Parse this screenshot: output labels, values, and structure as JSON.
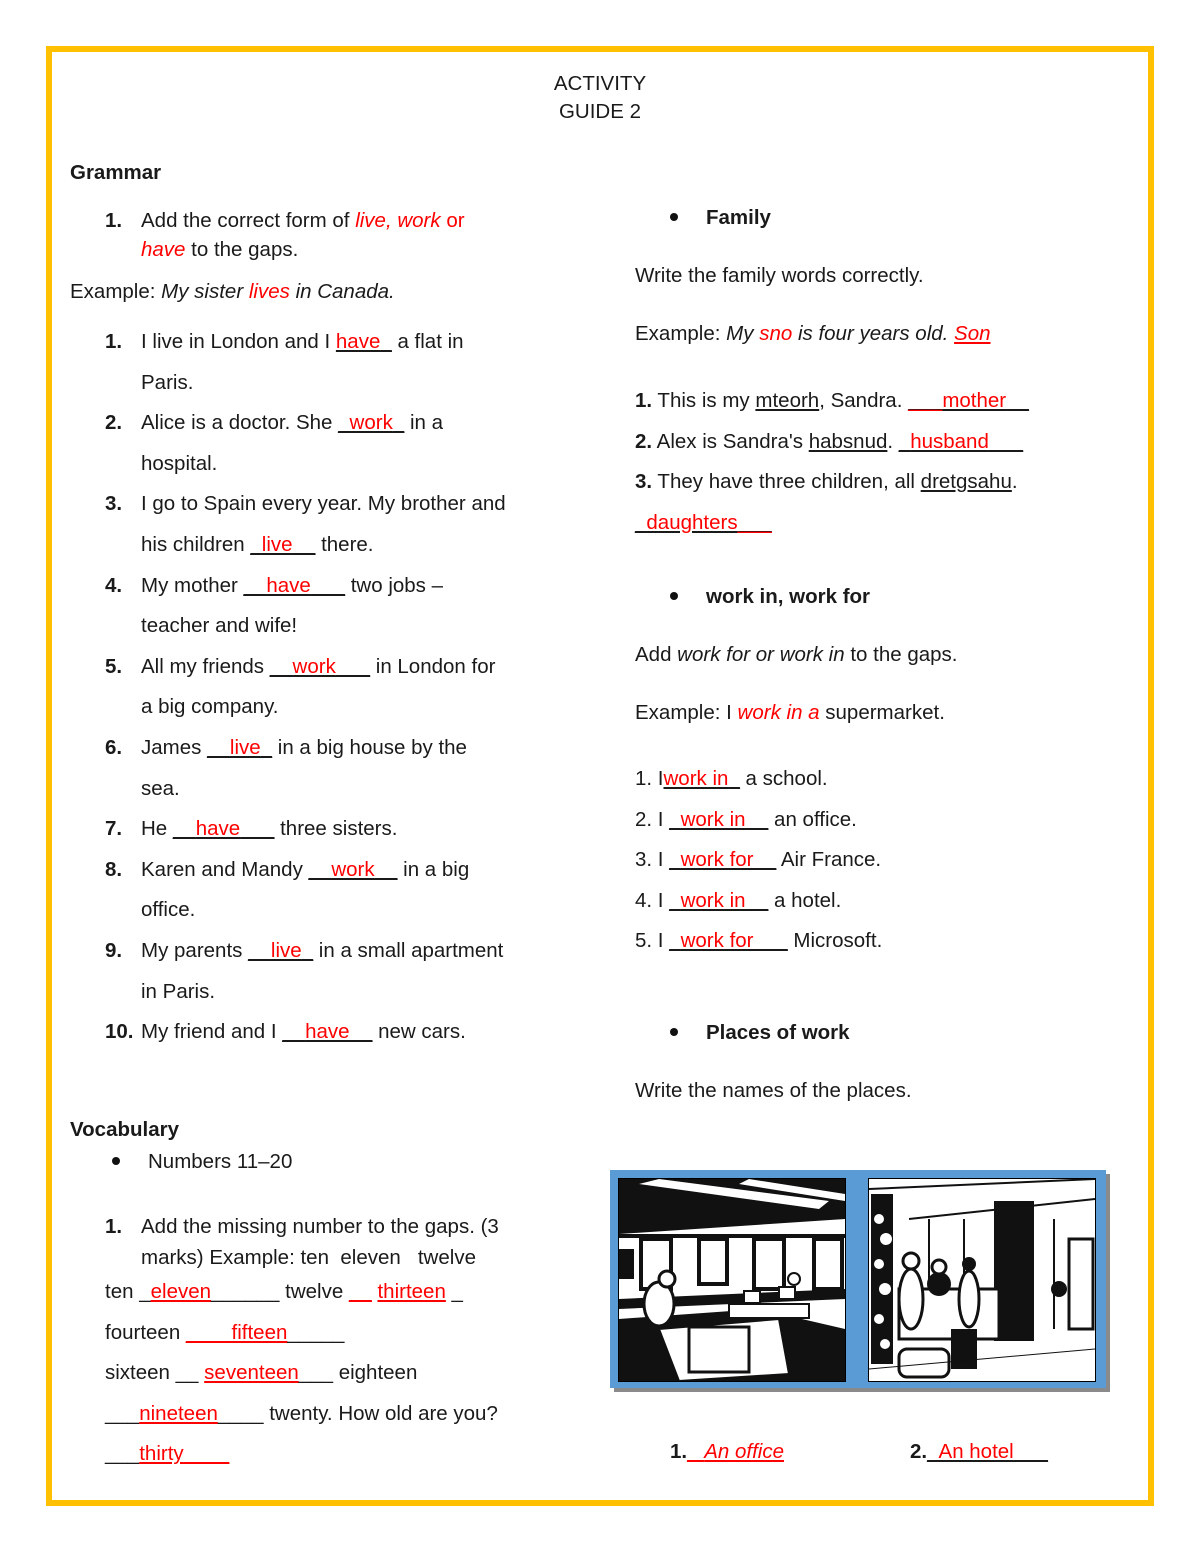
{
  "header": {
    "title_line1": "ACTIVITY",
    "title_line2": "GUIDE 2"
  },
  "grammar": {
    "heading": "Grammar",
    "instruction": {
      "number": "1.",
      "text_a": "Add the correct form of ",
      "options": "live, work",
      "text_b": " or",
      "option_have": "have",
      "text_c": " to the gaps."
    },
    "example": {
      "label": "Example: ",
      "pre": "My sister ",
      "answer": "lives",
      "post": " in Canada."
    },
    "items": [
      {
        "number": "1.",
        "pre": "I live in London and I ",
        "lead": "",
        "answer": "have",
        "trail": "_",
        "post": " a flat in",
        "cont": "Paris."
      },
      {
        "number": "2.",
        "pre": "Alice is a doctor. She ",
        "lead": "_",
        "answer": "work",
        "trail": "_",
        "post": " in a",
        "cont": "hospital."
      },
      {
        "number": "3.",
        "pre": "I go to Spain every year. My brother and",
        "cont_pre": "his children ",
        "lead": "_",
        "answer": "live",
        "trail": "__",
        "post": " there."
      },
      {
        "number": "4.",
        "pre": "My mother ",
        "lead": "__",
        "answer": "have",
        "trail": "___",
        "post": " two jobs –",
        "cont": "teacher and wife!"
      },
      {
        "number": "5.",
        "pre": "All my friends ",
        "lead": "__",
        "answer": "work",
        "trail": "___",
        "post": " in London for",
        "cont": "a big company."
      },
      {
        "number": "6.",
        "pre": "James ",
        "lead": "__",
        "answer": "live",
        "trail": "_",
        "post": " in a big house by the",
        "cont": "sea."
      },
      {
        "number": "7.",
        "pre": "He ",
        "lead": "__",
        "answer": "have",
        "trail": "___",
        "post": " three sisters."
      },
      {
        "number": "8.",
        "pre": "Karen and Mandy ",
        "lead": "__",
        "answer": "work",
        "trail": "__",
        "post": " in a big",
        "cont": "office."
      },
      {
        "number": "9.",
        "pre": "My parents ",
        "lead": "__",
        "answer": "live",
        "trail": "_",
        "post": " in a small apartment",
        "cont": "in Paris."
      },
      {
        "number": "10.",
        "pre": "My friend and I ",
        "lead": "__",
        "answer": "have",
        "trail": "__",
        "post": " new cars."
      }
    ]
  },
  "vocabulary": {
    "heading": "Vocabulary",
    "bullet": "Numbers 11–20",
    "instruction": {
      "number": "1.",
      "line1": "Add the missing number to the gaps. (3",
      "line2": "marks) Example: ten  eleven   twelve"
    },
    "lines": [
      {
        "parts": [
          {
            "text": "ten ",
            "type": "plain"
          },
          {
            "text": "_",
            "type": "blank"
          },
          {
            "text": "eleven",
            "type": "answer"
          },
          {
            "text": "______",
            "type": "blank"
          },
          {
            "text": " twelve ",
            "type": "plain"
          },
          {
            "text": "__",
            "type": "redblank"
          },
          {
            "text": " ",
            "type": "plain"
          },
          {
            "text": "thirteen",
            "type": "answer"
          },
          {
            "text": " _",
            "type": "plain"
          }
        ]
      },
      {
        "parts": [
          {
            "text": "fourteen ",
            "type": "plain"
          },
          {
            "text": "____",
            "type": "redblank"
          },
          {
            "text": "fifteen",
            "type": "answer"
          },
          {
            "text": "_____",
            "type": "blank"
          }
        ]
      },
      {
        "parts": [
          {
            "text": "sixteen ",
            "type": "plain"
          },
          {
            "text": "__",
            "type": "blank"
          },
          {
            "text": " ",
            "type": "plain"
          },
          {
            "text": "seventeen",
            "type": "answer"
          },
          {
            "text": "___",
            "type": "blank"
          },
          {
            "text": " eighteen",
            "type": "plain"
          }
        ]
      },
      {
        "parts": [
          {
            "text": "___",
            "type": "blank"
          },
          {
            "text": "nineteen",
            "type": "answer"
          },
          {
            "text": "____",
            "type": "blank"
          },
          {
            "text": " twenty. How old are you?",
            "type": "plain"
          }
        ]
      },
      {
        "parts": [
          {
            "text": "___",
            "type": "blank"
          },
          {
            "text": "thirty",
            "type": "answer"
          },
          {
            "text": "____",
            "type": "redblank"
          }
        ]
      }
    ]
  },
  "family": {
    "heading": "Family",
    "instruction": "Write the family words correctly.",
    "example": {
      "label": "Example: ",
      "pre": "My ",
      "scrambled": "sno",
      "post": " is four years old. ",
      "answer": "Son"
    },
    "items": [
      {
        "number": "1.",
        "pre": " This is my ",
        "scrambled": "mteorh",
        "post": ", Sandra. ",
        "lead": "___",
        "answer": "mother",
        "trail": "__"
      },
      {
        "number": "2.",
        "pre": " Alex is Sandra's ",
        "scrambled": "habsnud",
        "post": ". ",
        "lead": "_",
        "answer": "husband",
        "trail": "___"
      },
      {
        "number": "3.",
        "pre": " They have three children, all ",
        "scrambled": "dretgsahu",
        "post": ".",
        "lead": "_",
        "answer": "daughters",
        "trail": "___"
      }
    ]
  },
  "work_in_for": {
    "heading": "work in, work for",
    "instruction": {
      "pre": "Add ",
      "italic": "work for or work in",
      "post": " to the gaps."
    },
    "example": {
      "label": "Example: I ",
      "answer": "work in a",
      "post": " supermarket."
    },
    "items": [
      {
        "number": "1. I",
        "lead": "",
        "answer": "work in",
        "trail": "_",
        "post": " a school."
      },
      {
        "number": "2. I ",
        "lead": "_",
        "answer": "work in",
        "trail": "__",
        "post": " an office."
      },
      {
        "number": "3. I ",
        "lead": "_",
        "answer": "work for",
        "trail": "__",
        "post": " Air France."
      },
      {
        "number": "4. I ",
        "lead": "_",
        "answer": "work in",
        "trail": "__",
        "post": " a hotel."
      },
      {
        "number": "5. I ",
        "lead": "_",
        "answer": "work for",
        "trail": "___",
        "post": " Microsoft."
      }
    ]
  },
  "places_of_work": {
    "heading": "Places of work",
    "instruction": "Write the names of the places.",
    "images": [
      {
        "alt": "office illustration"
      },
      {
        "alt": "hotel reception illustration"
      }
    ],
    "answers": [
      {
        "number": "1.",
        "lead": "_ ",
        "answer": "An office",
        "trail": ""
      },
      {
        "number": "2.",
        "lead": "_",
        "answer": "An hotel",
        "trail": "___"
      }
    ]
  },
  "colors": {
    "border": "#ffc000",
    "answer": "#ff0000",
    "image_frame": "#5b9bd5"
  }
}
